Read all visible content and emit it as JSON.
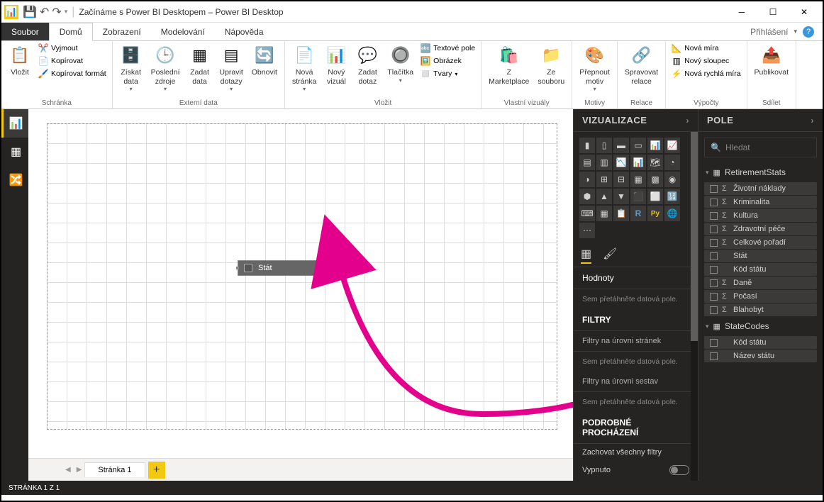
{
  "titlebar": {
    "title": "Začínáme s Power BI Desktopem – Power BI Desktop"
  },
  "menutabs": {
    "file": "Soubor",
    "tabs": [
      "Domů",
      "Zobrazení",
      "Modelování",
      "Nápověda"
    ],
    "signin": "Přihlášení"
  },
  "ribbon": {
    "clipboard": {
      "paste": "Vložit",
      "cut": "Vyjmout",
      "copy": "Kopírovat",
      "format": "Kopírovat formát",
      "label": "Schránka"
    },
    "data": {
      "get": "Získat\ndata",
      "recent": "Poslední\nzdroje",
      "enter": "Zadat\ndata",
      "edit": "Upravit\ndotazy",
      "refresh": "Obnovit",
      "label": "Externí data"
    },
    "insert": {
      "page": "Nová\nstránka",
      "visual": "Nový\nvizuál",
      "ask": "Zadat\ndotaz",
      "buttons": "Tlačítka",
      "textbox": "Textové pole",
      "image": "Obrázek",
      "shapes": "Tvary",
      "label": "Vložit"
    },
    "custom": {
      "market": "Z\nMarketplace",
      "file": "Ze\nsouboru",
      "label": "Vlastní vizuály"
    },
    "themes": {
      "switch": "Přepnout\nmotiv",
      "label": "Motivy"
    },
    "relations": {
      "manage": "Spravovat\nrelace",
      "label": "Relace"
    },
    "calc": {
      "measure": "Nová míra",
      "column": "Nový sloupec",
      "quick": "Nová rychlá míra",
      "label": "Výpočty"
    },
    "share": {
      "publish": "Publikovat",
      "label": "Sdílet"
    }
  },
  "canvas": {
    "page_tab": "Stránka 1",
    "drag_field": "Stát"
  },
  "viz": {
    "title": "VIZUALIZACE",
    "values": "Hodnoty",
    "values_ph": "Sem přetáhněte datová pole.",
    "filters": "FILTRY",
    "page_filters": "Filtry na úrovni stránek",
    "page_filters_ph": "Sem přetáhněte datová pole.",
    "report_filters": "Filtry na úrovni sestav",
    "report_filters_ph": "Sem přetáhněte datová pole.",
    "drill": "PODROBNÉ PROCHÁZENÍ",
    "keep_filters": "Zachovat všechny filtry",
    "off": "Vypnuto"
  },
  "fields": {
    "title": "POLE",
    "search": "Hledat",
    "tables": [
      {
        "name": "RetirementStats",
        "expanded": true,
        "fields": [
          {
            "name": "Životní náklady",
            "agg": true
          },
          {
            "name": "Kriminalita",
            "agg": true
          },
          {
            "name": "Kultura",
            "agg": true
          },
          {
            "name": "Zdravotní péče",
            "agg": true
          },
          {
            "name": "Celkové pořadí",
            "agg": true
          },
          {
            "name": "Stát",
            "agg": false
          },
          {
            "name": "Kód státu",
            "agg": false
          },
          {
            "name": "Daně",
            "agg": true
          },
          {
            "name": "Počasí",
            "agg": true
          },
          {
            "name": "Blahobyt",
            "agg": true
          }
        ]
      },
      {
        "name": "StateCodes",
        "expanded": true,
        "fields": [
          {
            "name": "Kód státu",
            "agg": false
          },
          {
            "name": "Název státu",
            "agg": false
          }
        ]
      }
    ]
  },
  "statusbar": {
    "page": "STRÁNKA 1 Z 1"
  }
}
